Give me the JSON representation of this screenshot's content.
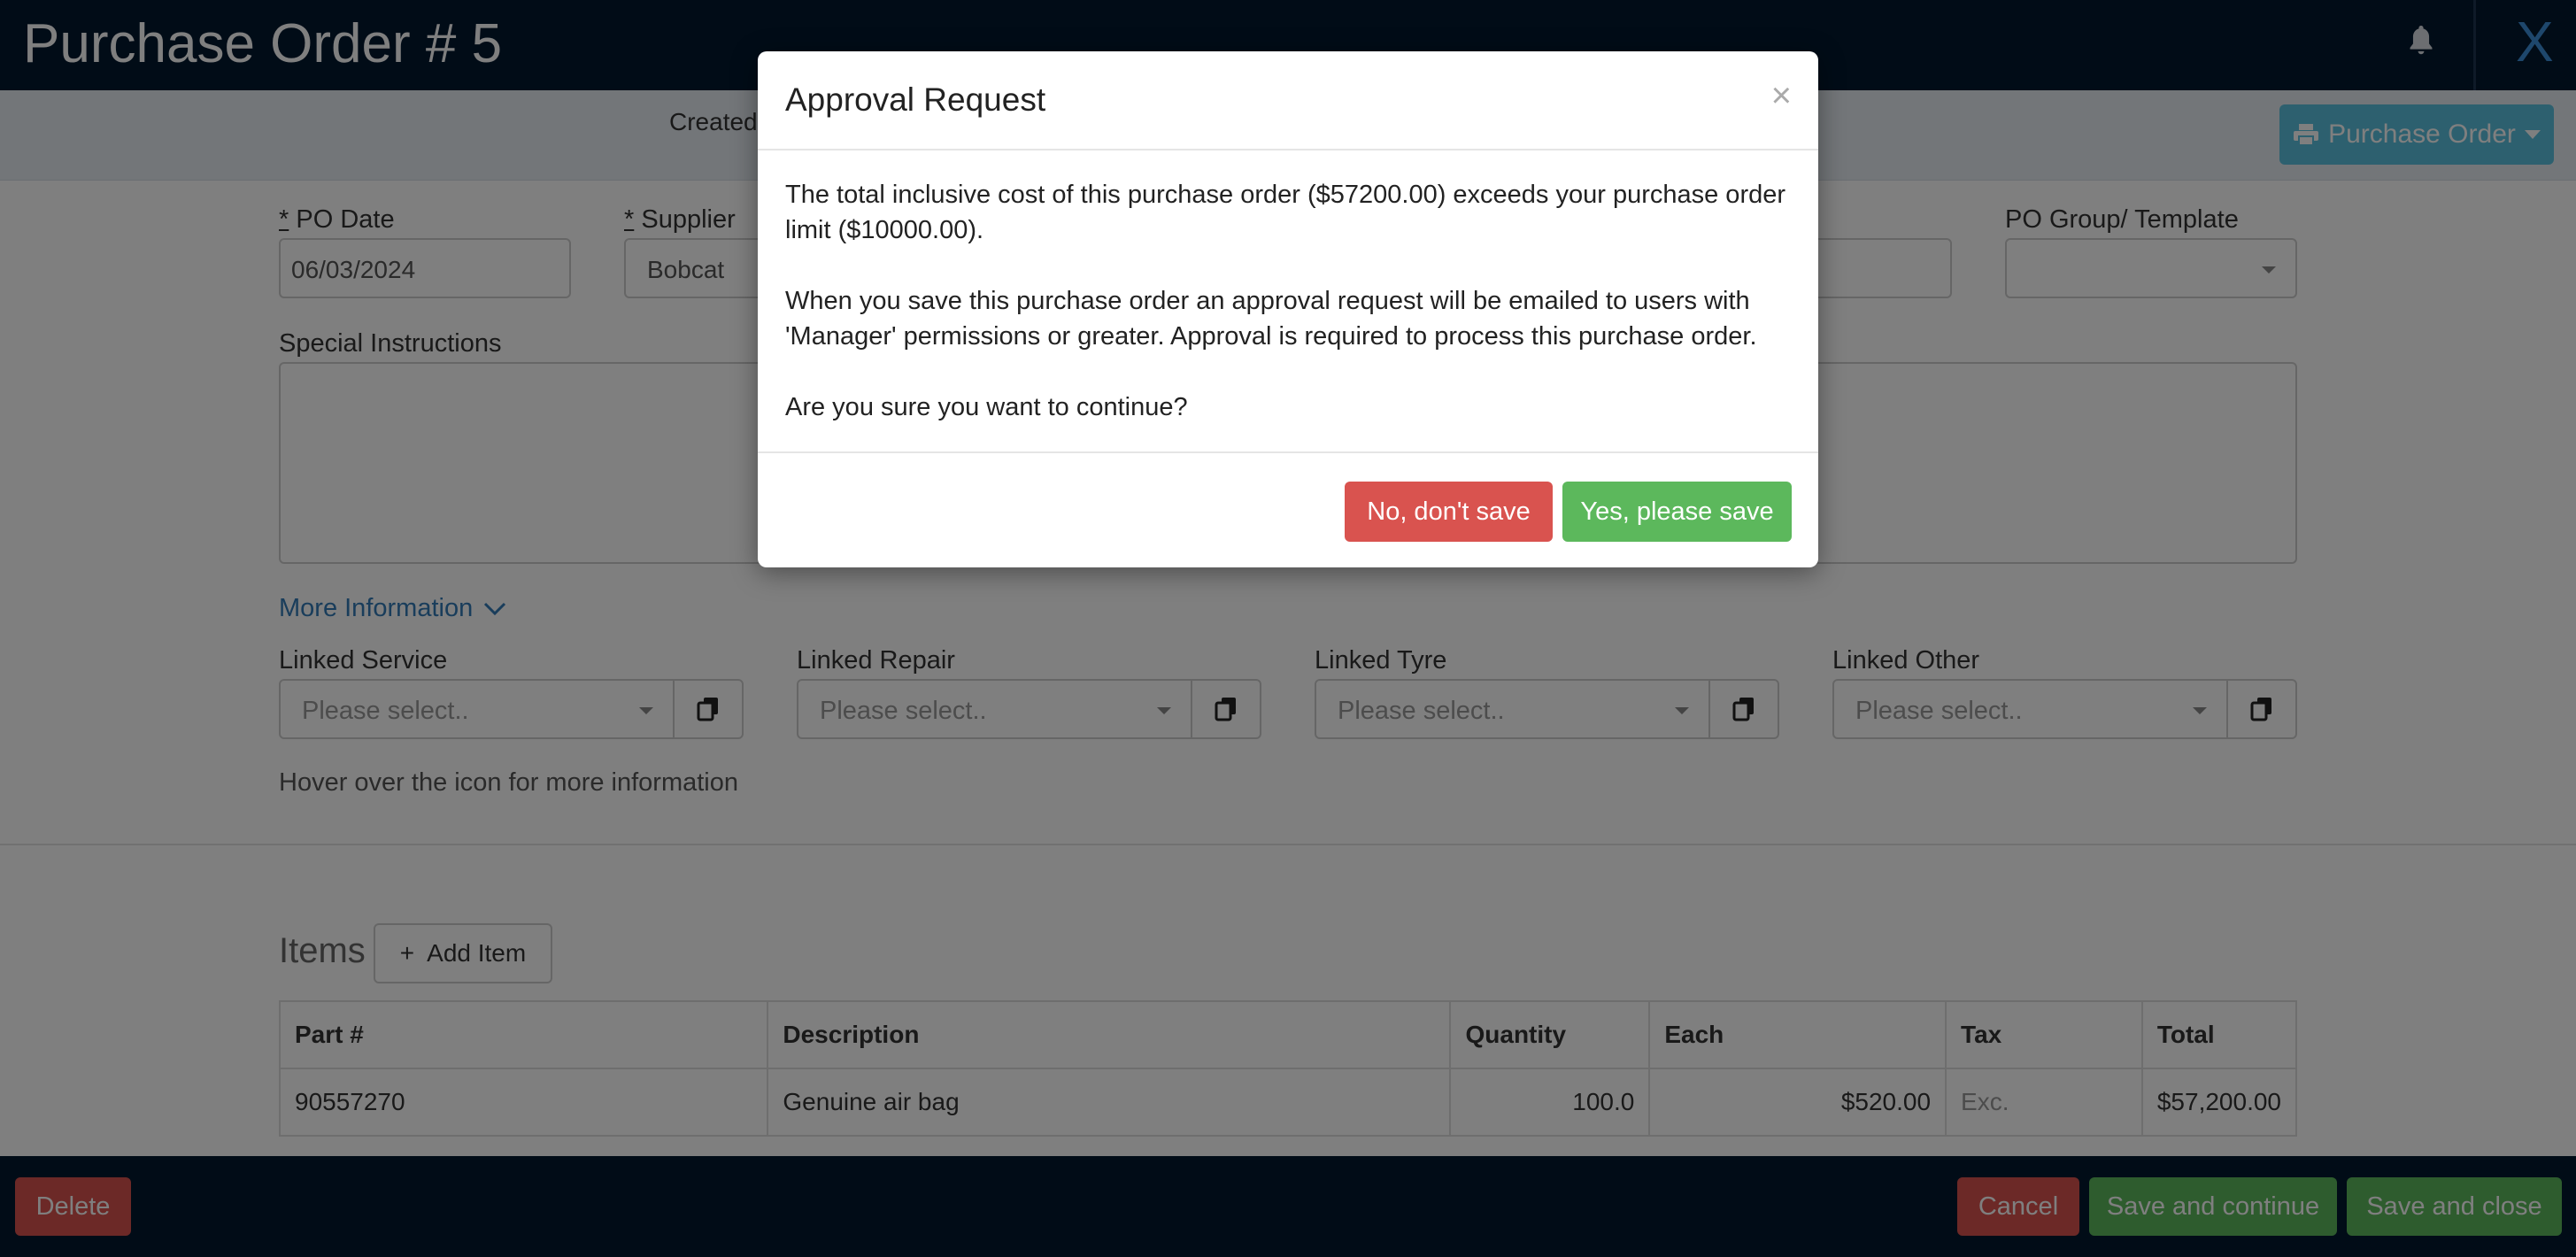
{
  "header": {
    "title": "Purchase Order # 5",
    "close_label": "X",
    "bell_icon": "bell-icon"
  },
  "subbar": {
    "created_text": "Created",
    "po_button_label": "Purchase Order",
    "print_icon": "printer-icon"
  },
  "form": {
    "po_date": {
      "label": "PO Date",
      "required_mark": "*",
      "value": "06/03/2024"
    },
    "supplier": {
      "label": "Supplier",
      "required_mark": "*",
      "value": "Bobcat"
    },
    "po_group": {
      "label": "PO Group/ Template",
      "value": ""
    },
    "special_instructions": {
      "label": "Special Instructions",
      "value": ""
    },
    "more_information": "More Information",
    "linked": [
      {
        "label": "Linked Service",
        "placeholder": "Please select.."
      },
      {
        "label": "Linked Repair",
        "placeholder": "Please select.."
      },
      {
        "label": "Linked Tyre",
        "placeholder": "Please select.."
      },
      {
        "label": "Linked Other",
        "placeholder": "Please select.."
      }
    ],
    "hover_note": "Hover over the icon for more information"
  },
  "items": {
    "title": "Items",
    "add_item_label": "Add Item",
    "columns": [
      "Part #",
      "Description",
      "Quantity",
      "Each",
      "Tax",
      "Total"
    ],
    "rows": [
      {
        "part": "90557270",
        "description": "Genuine air bag",
        "quantity": "100.0",
        "each": "$520.00",
        "tax": "Exc.",
        "total": "$57,200.00"
      }
    ]
  },
  "footer": {
    "delete_label": "Delete",
    "cancel_label": "Cancel",
    "save_continue_label": "Save and continue",
    "save_close_label": "Save and close"
  },
  "modal": {
    "title": "Approval Request",
    "close_symbol": "×",
    "paragraph1": "The total inclusive cost of this purchase order ($57200.00) exceeds your purchase order limit ($10000.00).",
    "paragraph2": "When you save this purchase order an approval request will be emailed to users with 'Manager' permissions or greater. Approval is required to process this purchase order.",
    "paragraph3": "Are you sure you want to continue?",
    "no_label": "No, don't save",
    "yes_label": "Yes, please save"
  },
  "colors": {
    "header_bg": "#03182e",
    "accent_blue": "#337ab7",
    "info_button": "#5bc0de",
    "danger": "#d9534f",
    "success": "#5cb85c"
  }
}
